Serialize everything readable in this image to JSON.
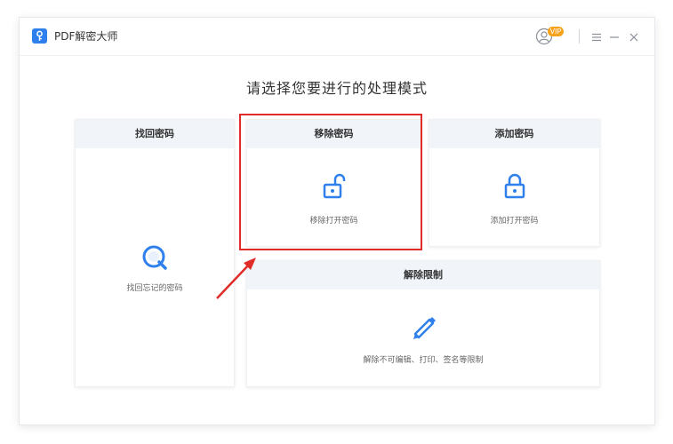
{
  "window": {
    "title": "PDF解密大师",
    "vip_badge": "VIP"
  },
  "heading": "请选择您要进行的处理模式",
  "cards": {
    "recover": {
      "title": "找回密码",
      "desc": "找回忘记的密码",
      "icon": "magnifier-icon"
    },
    "remove": {
      "title": "移除密码",
      "desc": "移除打开密码",
      "icon": "unlock-icon"
    },
    "add": {
      "title": "添加密码",
      "desc": "添加打开密码",
      "icon": "lock-icon"
    },
    "restrict": {
      "title": "解除限制",
      "desc": "解除不可编辑、打印、签名等限制",
      "icon": "pencil-icon"
    }
  },
  "colors": {
    "accent": "#2f80ed",
    "highlight": "#e02b27",
    "card_header": "#f1f5fa"
  }
}
